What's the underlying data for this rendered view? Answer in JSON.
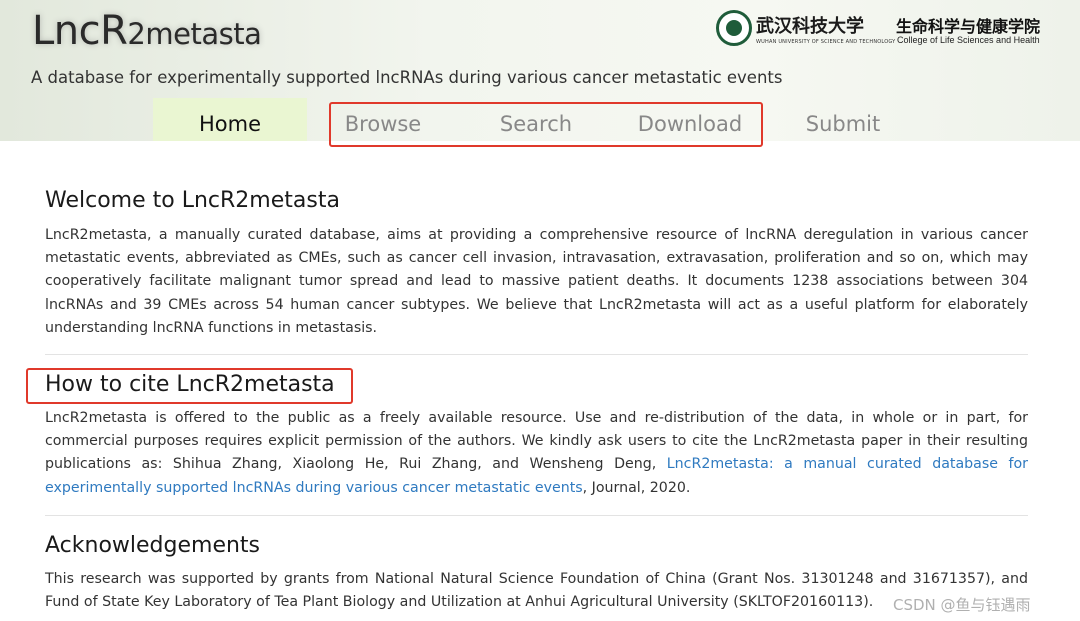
{
  "header": {
    "title_big": "LncR",
    "title_small": "2metasta",
    "subtitle": "A database for experimentally supported lncRNAs during various cancer metastatic events",
    "university_cn": "武汉科技大学",
    "university_en": "WUHAN UNIVERSITY OF SCIENCE AND TECHNOLOGY",
    "college_cn": "生命科学与健康学院",
    "college_en": "College of Life Sciences and Health"
  },
  "nav": {
    "home": "Home",
    "browse": "Browse",
    "search": "Search",
    "download": "Download",
    "submit": "Submit"
  },
  "welcome": {
    "title": "Welcome to LncR2metasta",
    "body": "LncR2metasta, a manually curated database, aims at providing a comprehensive resource of lncRNA deregulation in various cancer metastatic events, abbreviated as CMEs, such as cancer cell invasion, intravasation, extravasation, proliferation and so on, which may cooperatively facilitate malignant tumor spread and lead to massive patient deaths. It documents 1238 associations between 304 lncRNAs and 39 CMEs across 54 human cancer subtypes. We believe that LncR2metasta will act as a useful platform for elaborately understanding lncRNA functions in metastasis."
  },
  "cite": {
    "title": "How to cite LncR2metasta",
    "body": "LncR2metasta is offered to the public as a freely available resource. Use and re-distribution of the data, in whole or in part, for commercial purposes requires explicit permission of the authors. We kindly ask users to cite the LncR2metasta paper in their resulting publications as:",
    "authors": "Shihua Zhang, Xiaolong He, Rui Zhang, and Wensheng Deng, ",
    "paper_link": "LncR2metasta: a manual curated database for experimentally supported lncRNAs during various cancer metastatic events",
    "journal": ", Journal, 2020."
  },
  "ack": {
    "title": "Acknowledgements",
    "body": "This research was supported by grants from National Natural Science Foundation of China (Grant Nos. 31301248 and 31671357), and Fund of State Key Laboratory of Tea Plant Biology and Utilization at Anhui Agricultural University (SKLTOF20160113)."
  },
  "watermark": "CSDN @鱼与钰遇雨",
  "colors": {
    "highlight": "#e0392b",
    "link": "#2f7ac0",
    "home_tab": "#eaf6d2",
    "seal": "#1f5c3a"
  }
}
